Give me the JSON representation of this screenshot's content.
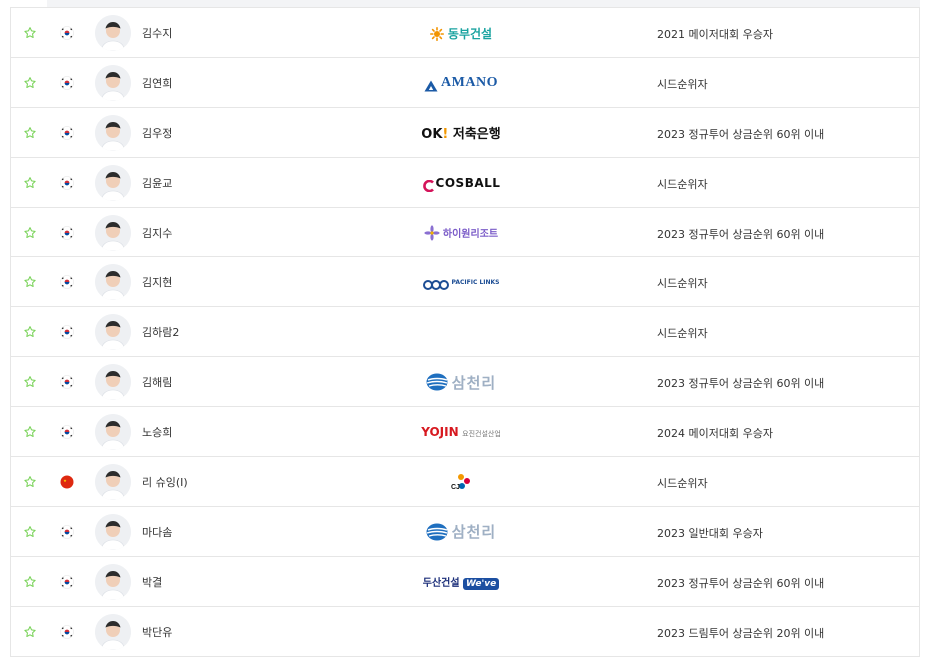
{
  "colors": {
    "star": "#7ad35a",
    "border": "#e6e6e6",
    "korea_red": "#cd2e3a",
    "korea_blue": "#0047a0",
    "china_red": "#de2910"
  },
  "rows": [
    {
      "name": "김수지",
      "flag": "korea",
      "sponsor": {
        "type": "dongbu",
        "text": "동부건설"
      },
      "qualification": "2021 메이저대회 우승자"
    },
    {
      "name": "김연희",
      "flag": "korea",
      "sponsor": {
        "type": "amano",
        "text": "AMANO"
      },
      "qualification": "시드순위자"
    },
    {
      "name": "김우정",
      "flag": "korea",
      "sponsor": {
        "type": "ok",
        "text": "OK! 저축은행"
      },
      "qualification": "2023 정규투어 상금순위 60위 이내"
    },
    {
      "name": "김윤교",
      "flag": "korea",
      "sponsor": {
        "type": "cosball",
        "text": "COSBALL"
      },
      "qualification": "시드순위자"
    },
    {
      "name": "김지수",
      "flag": "korea",
      "sponsor": {
        "type": "high1",
        "text": "하이원리조트"
      },
      "qualification": "2023 정규투어 상금순위 60위 이내"
    },
    {
      "name": "김지현",
      "flag": "korea",
      "sponsor": {
        "type": "pacific",
        "text": "PACIFIC LINKS"
      },
      "qualification": "시드순위자"
    },
    {
      "name": "김하람2",
      "flag": "korea",
      "sponsor": {
        "type": "none",
        "text": ""
      },
      "qualification": "시드순위자"
    },
    {
      "name": "김해림",
      "flag": "korea",
      "sponsor": {
        "type": "samchully",
        "text": "삼천리"
      },
      "qualification": "2023 정규투어 상금순위 60위 이내"
    },
    {
      "name": "노승희",
      "flag": "korea",
      "sponsor": {
        "type": "yojin",
        "text": "YOJIN 요진건설산업"
      },
      "qualification": "2024 메이저대회 우승자"
    },
    {
      "name": "리 슈잉(I)",
      "flag": "china",
      "sponsor": {
        "type": "cj",
        "text": "CJ"
      },
      "qualification": "시드순위자"
    },
    {
      "name": "마다솜",
      "flag": "korea",
      "sponsor": {
        "type": "samchully",
        "text": "삼천리"
      },
      "qualification": "2023 일반대회 우승자"
    },
    {
      "name": "박결",
      "flag": "korea",
      "sponsor": {
        "type": "doosan",
        "text": "두산건설 We've"
      },
      "qualification": "2023 정규투어 상금순위 60위 이내"
    },
    {
      "name": "박단유",
      "flag": "korea",
      "sponsor": {
        "type": "none",
        "text": ""
      },
      "qualification": "2023 드림투어 상금순위 20위 이내"
    }
  ]
}
